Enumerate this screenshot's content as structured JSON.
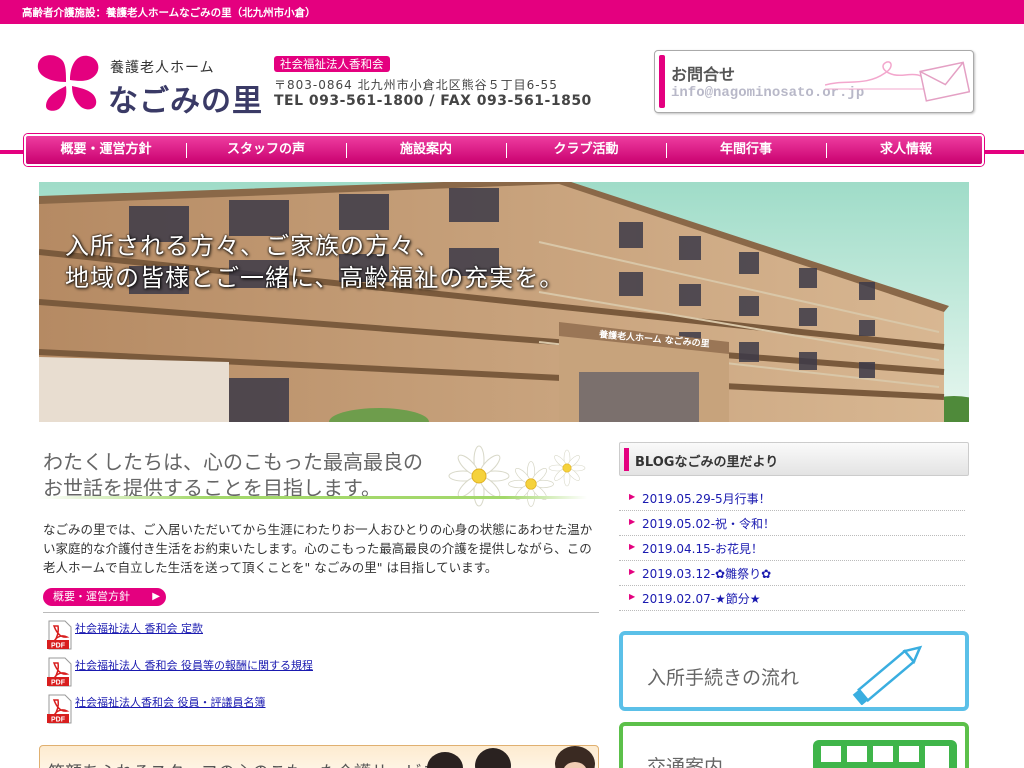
{
  "topbar": {
    "text": "高齢者介護施設：養護老人ホームなごみの里（北九州市小倉）"
  },
  "header": {
    "logo_sub": "養護老人ホーム",
    "logo_main": "なごみの里",
    "corp_badge": "社会福祉法人香和会",
    "address": "〒803-0864 北九州市小倉北区熊谷５丁目6-55",
    "phone": "TEL 093-561-1800 / FAX 093-561-1850",
    "contact_title": "お問合せ",
    "contact_email": "info@nagominosato.or.jp"
  },
  "nav": {
    "items": [
      "概要・運営方針",
      "スタッフの声",
      "施設案内",
      "クラブ活動",
      "年間行事",
      "求人情報"
    ]
  },
  "hero": {
    "line1": "入所される方々、ご家族の方々、",
    "line2": "地域の皆様とご一緒に、高齢福祉の充実を。",
    "sign_text": "養護老人ホーム なごみの里"
  },
  "main": {
    "mission_line1": "わたくしたちは、心のこもった最高最良の",
    "mission_line2": "お世話を提供することを目指します。",
    "description": "なごみの里では、ご入居いただいてから生涯にわたりお一人おひとりの心身の状態にあわせた温かい家庭的な介護付き生活をお約束いたします。心のこもった最高最良の介護を提供しながら、この老人ホームで自立した生活を送って頂くことを\" なごみの里\" は目指しています。",
    "policy_button": "概要・運営方針",
    "pdf_label": "PDF",
    "pdf_links": [
      "社会福祉法人 香和会 定款",
      "社会福祉法人 香和会 役員等の報酬に関する規程",
      "社会福祉法人香和会 役員・評議員名簿"
    ],
    "staff_banner": "笑顔あふれるスタッフの心のこもった介護サービス"
  },
  "sidebar": {
    "blog_title": "BLOGなごみの里だより",
    "blog_items": [
      "2019.05.29-5月行事！",
      "2019.05.02-祝・令和！",
      "2019.04.15-お花見！",
      "2019.03.12-✿雛祭り✿",
      "2019.02.07-★節分★"
    ],
    "admission_flow": "入所手続きの流れ",
    "access": "交通案内"
  },
  "colors": {
    "brand_pink": "#e4007f",
    "link_blue": "#1a1ab0",
    "admission_border": "#5bc0e8",
    "access_border": "#5cc04a"
  },
  "icons": [
    "logo-flower-icon",
    "envelope-icon",
    "pdf-icon",
    "pencil-icon",
    "bus-icon",
    "daisy-icon"
  ]
}
